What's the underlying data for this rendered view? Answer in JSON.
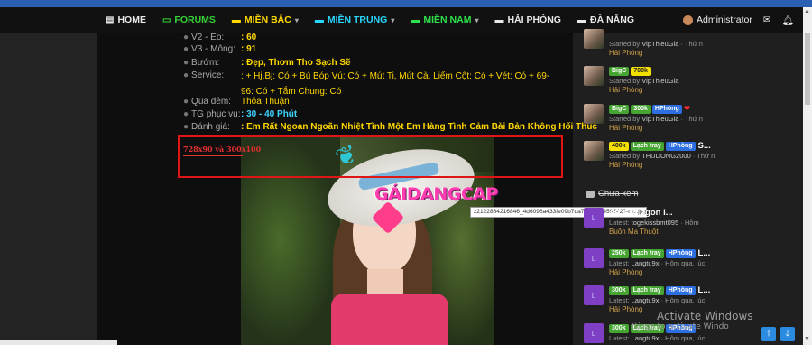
{
  "nav": {
    "items": [
      {
        "label": "HOME",
        "icon": "home-icon",
        "color": "#e8e8e8",
        "caret": false
      },
      {
        "label": "FORUMS",
        "icon": "chat-icon",
        "color": "#36d236",
        "caret": false
      },
      {
        "label": "MIỀN BẮC",
        "icon": "folder-icon",
        "color": "#ffd800",
        "caret": true
      },
      {
        "label": "MIỀN TRUNG",
        "icon": "folder-icon",
        "color": "#2ad7ff",
        "caret": true
      },
      {
        "label": "MIỀN NAM",
        "icon": "folder-icon",
        "color": "#2ee04a",
        "caret": true
      },
      {
        "label": "HẢI PHÒNG",
        "icon": "folder-icon",
        "color": "#e8e8e8",
        "caret": false
      },
      {
        "label": "ĐÀ NẴNG",
        "icon": "folder-icon",
        "color": "#e8e8e8",
        "caret": false
      }
    ],
    "user": "Administrator"
  },
  "info": {
    "rows": [
      {
        "label": "V2 - Eo:",
        "value": ": 60"
      },
      {
        "label": "V3 - Mông:",
        "value": ": 91"
      },
      {
        "label": "Bướm:",
        "value": ": Đẹp, Thơm Tho Sạch Sẽ"
      },
      {
        "label": "Service:",
        "value": ""
      },
      {
        "label": "Qua đêm:",
        "value": "Thỏa Thuận"
      },
      {
        "label": "TG phục vụ:",
        "value": ": 30 - 40 Phút"
      },
      {
        "label": "Đánh giá:",
        "value": ": Em Rất Ngoan Ngoãn Nhiệt Tình Một Em Hàng Tình Cảm Bài Bản Không Hối Thúc"
      }
    ],
    "service_text": ": + Hj,Bj: Có + Bú Bóp Vú: Có + Mút Ti, Mút Cà, Liếm Cột: Có + Vét: Có + 69-96: Có + Tắm Chung: Có"
  },
  "ad": {
    "label": "728x90 và 300x100"
  },
  "photo": {
    "logo_text": "GÁIDANGCAP"
  },
  "tooltip": {
    "text": "z2122884216846_4d6096a433fe09b7da7ccc5b04595423-md.jpg"
  },
  "sidebar": {
    "threads_top": [
      {
        "badges": [],
        "title": "",
        "line2_prefix": "Started by",
        "author": "VipThieuGia",
        "time": "Thứ n",
        "region": "Hải Phòng"
      },
      {
        "badges": [
          {
            "text": "BigC",
            "style": "green"
          },
          {
            "text": "700k",
            "style": "yellow"
          }
        ],
        "title": "",
        "line2_prefix": "Started by",
        "author": "VipThieuGia",
        "time": "",
        "region": "Hải Phòng"
      },
      {
        "badges": [
          {
            "text": "BigC",
            "style": "green"
          },
          {
            "text": "300k",
            "style": "green"
          },
          {
            "text": "HPhòng",
            "style": "blue"
          }
        ],
        "title": "",
        "heart": true,
        "line2_prefix": "Started by",
        "author": "VipThieuGia",
        "time": "Thứ n",
        "region": "Hải Phòng"
      },
      {
        "badges": [
          {
            "text": "400k",
            "style": "yellow"
          },
          {
            "text": "Lạch tray",
            "style": "green"
          },
          {
            "text": "HPhòng",
            "style": "blue"
          }
        ],
        "title": "S...",
        "line2_prefix": "Started by",
        "author": "THUDONG2000",
        "time": "Thứ n",
        "region": "Hải Phòng"
      }
    ],
    "unread_title": "Chưa xem",
    "threads_unread": [
      {
        "badges": [],
        "title": "ần e út ngon l...",
        "line2_prefix": "Latest:",
        "author": "togekissbmt095",
        "time": "Hôm",
        "region": "Buôn Ma Thuột"
      },
      {
        "badges": [
          {
            "text": "250k",
            "style": "green"
          },
          {
            "text": "Lạch tray",
            "style": "green"
          },
          {
            "text": "HPhòng",
            "style": "blue"
          }
        ],
        "title": "L...",
        "line2_prefix": "Latest:",
        "author": "Langtu9x",
        "time": "Hôm qua, lúc",
        "region": "Hải Phòng"
      },
      {
        "badges": [
          {
            "text": "300k",
            "style": "green"
          },
          {
            "text": "Lạch tray",
            "style": "green"
          },
          {
            "text": "HPhòng",
            "style": "blue"
          }
        ],
        "title": "L...",
        "line2_prefix": "Latest:",
        "author": "Langtu9x",
        "time": "Hôm qua, lúc",
        "region": "Hải Phòng"
      },
      {
        "badges": [
          {
            "text": "300k",
            "style": "green"
          },
          {
            "text": "Lạch tray",
            "style": "green"
          },
          {
            "text": "HPhòng",
            "style": "blue"
          }
        ],
        "title": "",
        "line2_prefix": "Latest:",
        "author": "Langtu9x",
        "time": "Hôm qua, lúc",
        "region": ""
      }
    ]
  },
  "windows": {
    "activate_title": "Activate Windows",
    "activate_sub": "ttings to activate Windo"
  }
}
